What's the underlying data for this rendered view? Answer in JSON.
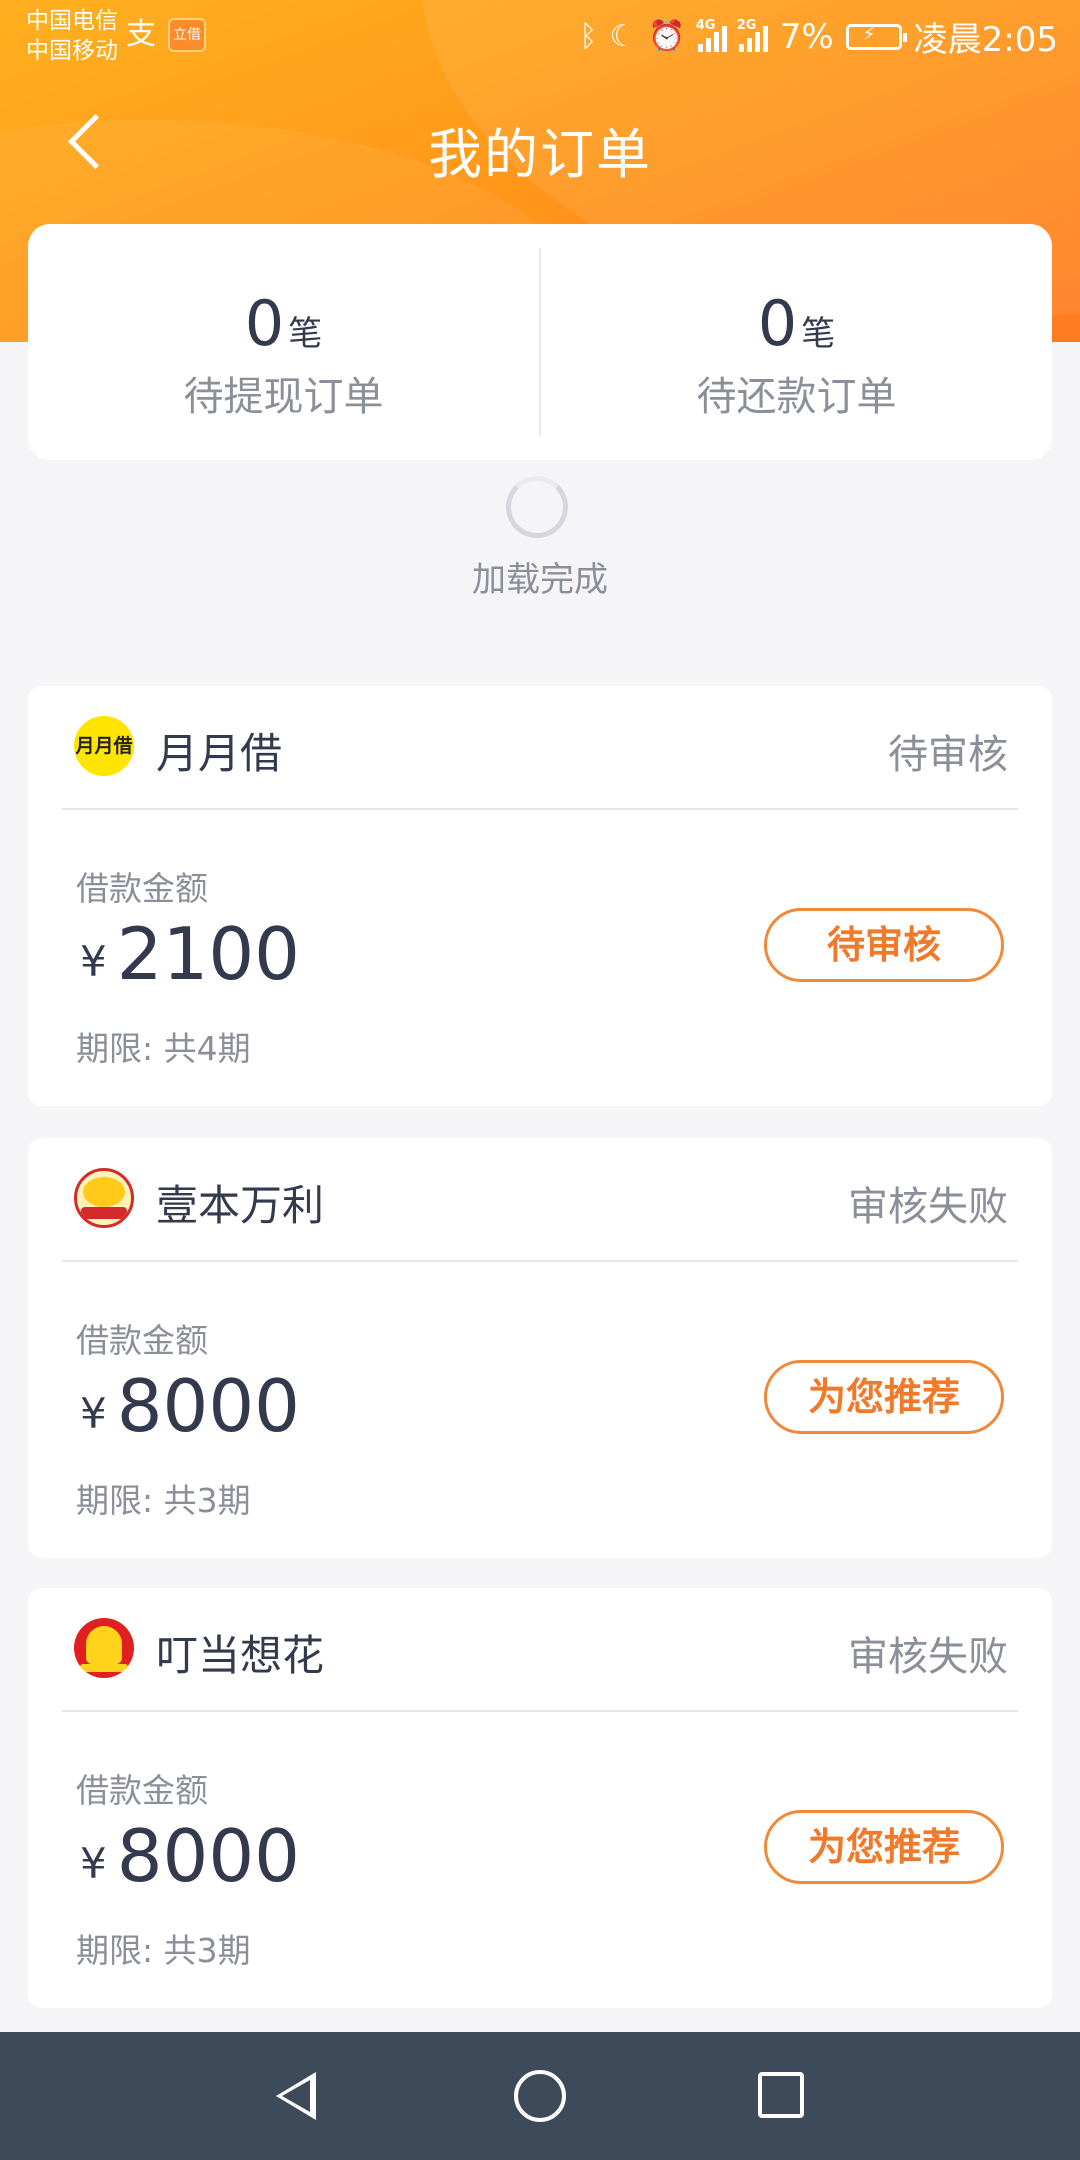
{
  "status_bar": {
    "carrier1": "中国电信",
    "carrier2": "中国移动",
    "alipay_glyph": "支",
    "lijie_badge": "立借",
    "network_label_1": "4G",
    "network_label_2": "2G",
    "battery": "7%",
    "time": "凌晨2:05"
  },
  "header": {
    "title": "我的订单"
  },
  "summary": [
    {
      "count": "0",
      "unit": "笔",
      "label": "待提现订单"
    },
    {
      "count": "0",
      "unit": "笔",
      "label": "待还款订单"
    }
  ],
  "loading": {
    "text": "加载完成"
  },
  "orders": [
    {
      "name": "月月借",
      "logo_text": "月月借",
      "status": "待审核",
      "amount_label": "借款金额",
      "currency": "¥",
      "amount": "2100",
      "term": "期限: 共4期",
      "action": "待审核"
    },
    {
      "name": "壹本万利",
      "status": "审核失败",
      "amount_label": "借款金额",
      "currency": "¥",
      "amount": "8000",
      "term": "期限: 共3期",
      "action": "为您推荐"
    },
    {
      "name": "叮当想花",
      "status": "审核失败",
      "amount_label": "借款金额",
      "currency": "¥",
      "amount": "8000",
      "term": "期限: 共3期",
      "action": "为您推荐"
    }
  ],
  "colors": {
    "brand_orange": "#ff9a1a",
    "accent_button": "#f08a3a",
    "nav_bar": "#3d4a5a"
  }
}
